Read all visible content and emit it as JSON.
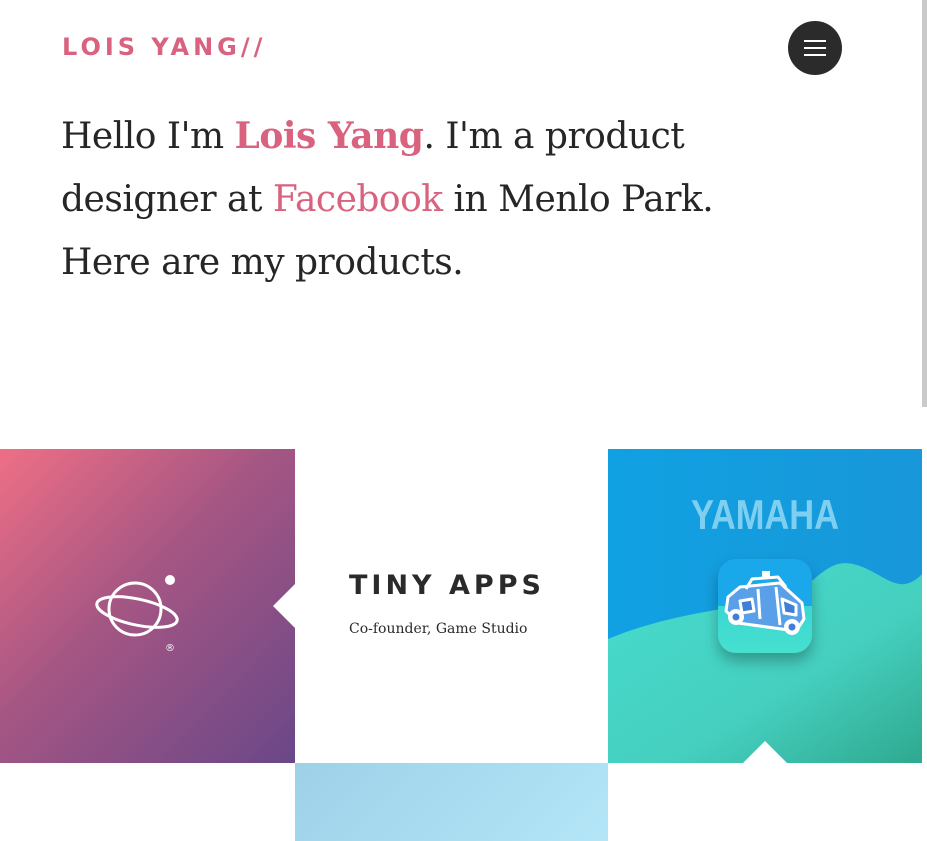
{
  "header": {
    "logo": "LOIS YANG//",
    "menu_icon": "hamburger-menu-icon"
  },
  "intro": {
    "part1": "Hello I'm ",
    "name": "Lois Yang",
    "part2": ". I'm a product designer at ",
    "company": "Facebook",
    "part3": " in Menlo Park. Here are my products."
  },
  "projects": [
    {
      "id": "tiny-apps",
      "title": "TINY APPS",
      "subtitle": "Co-founder, Game Studio",
      "logo_icon": "planet-logo-icon",
      "registered_mark": "®"
    },
    {
      "id": "yamaha",
      "brand": "YAMAHA",
      "icon": "golf-cart-app-icon"
    }
  ],
  "colors": {
    "accent": "#d9627f",
    "text": "#262626",
    "menu_bg": "#2b2b2b",
    "tiny_apps_gradient": [
      "#ee6f86",
      "#6a4788"
    ],
    "yamaha_blue": "#0f9fe0",
    "yamaha_teal": "#44d9c6"
  }
}
